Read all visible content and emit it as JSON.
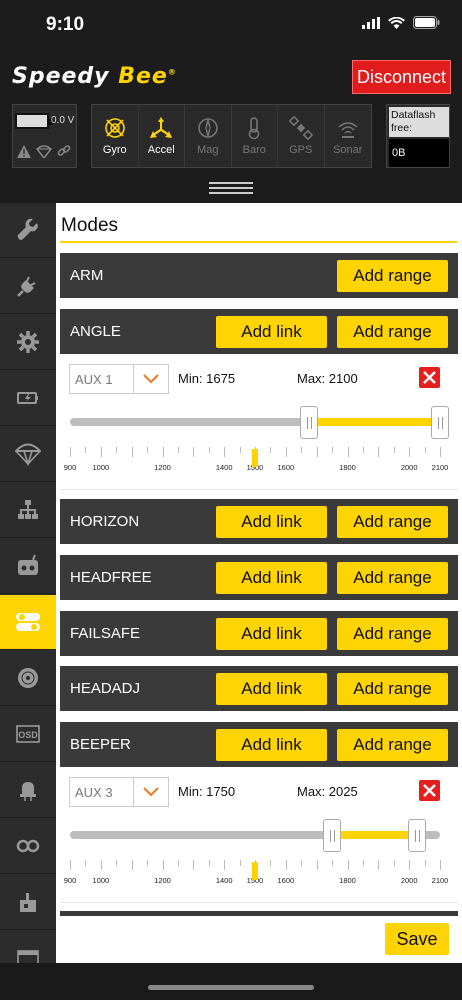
{
  "status": {
    "time": "9:10"
  },
  "header": {
    "logo_speedy": "Speedy",
    "logo_bee": "Bee",
    "logo_reg": "®",
    "disconnect_label": "Disconnect"
  },
  "battery": {
    "voltage": "0.0 V"
  },
  "sensors": [
    {
      "label": "Gyro",
      "icon": "gyro-icon",
      "active": true
    },
    {
      "label": "Accel",
      "icon": "accel-icon",
      "active": true
    },
    {
      "label": "Mag",
      "icon": "mag-icon",
      "active": false
    },
    {
      "label": "Baro",
      "icon": "baro-icon",
      "active": false
    },
    {
      "label": "GPS",
      "icon": "gps-icon",
      "active": false
    },
    {
      "label": "Sonar",
      "icon": "sonar-icon",
      "active": false
    }
  ],
  "dataflash": {
    "label": "Dataflash free:",
    "value": "0B"
  },
  "sidebar": {
    "items": [
      {
        "icon": "wrench-icon"
      },
      {
        "icon": "plug-icon"
      },
      {
        "icon": "gear-icon"
      },
      {
        "icon": "battery-icon"
      },
      {
        "icon": "parachute-icon"
      },
      {
        "icon": "network-icon"
      },
      {
        "icon": "receiver-icon"
      },
      {
        "icon": "modes-icon",
        "active": true
      },
      {
        "icon": "motor-icon"
      },
      {
        "icon": "osd-icon"
      },
      {
        "icon": "led-icon"
      },
      {
        "icon": "blackbox-icon"
      },
      {
        "icon": "cli-icon"
      },
      {
        "icon": "window-icon"
      }
    ]
  },
  "modes": {
    "title": "Modes",
    "add_link_label": "Add link",
    "add_range_label": "Add range",
    "rows": [
      {
        "name": "ARM",
        "has_link": false
      },
      {
        "name": "ANGLE",
        "has_link": true
      },
      {
        "name": "HORIZON",
        "has_link": true
      },
      {
        "name": "HEADFREE",
        "has_link": true
      },
      {
        "name": "FAILSAFE",
        "has_link": true
      },
      {
        "name": "HEADADJ",
        "has_link": true
      },
      {
        "name": "BEEPER",
        "has_link": true
      }
    ],
    "ranges": [
      {
        "mode": "ANGLE",
        "channel": "AUX 1",
        "min_label": "Min: 1675",
        "max_label": "Max: 2100",
        "min": 1675,
        "max": 2100,
        "current": 1500
      },
      {
        "mode": "BEEPER",
        "channel": "AUX 3",
        "min_label": "Min: 1750",
        "max_label": "Max: 2025",
        "min": 1750,
        "max": 2025,
        "current": 1500
      }
    ],
    "scale": {
      "from": 900,
      "to": 2100,
      "labels": [
        "900",
        "1000",
        "1200",
        "1400",
        "1500",
        "1600",
        "1800",
        "2000",
        "2100"
      ]
    },
    "save_label": "Save"
  },
  "colors": {
    "accent": "#ffd400",
    "danger": "#e11c1c",
    "row_bg": "#3a3a3a"
  }
}
